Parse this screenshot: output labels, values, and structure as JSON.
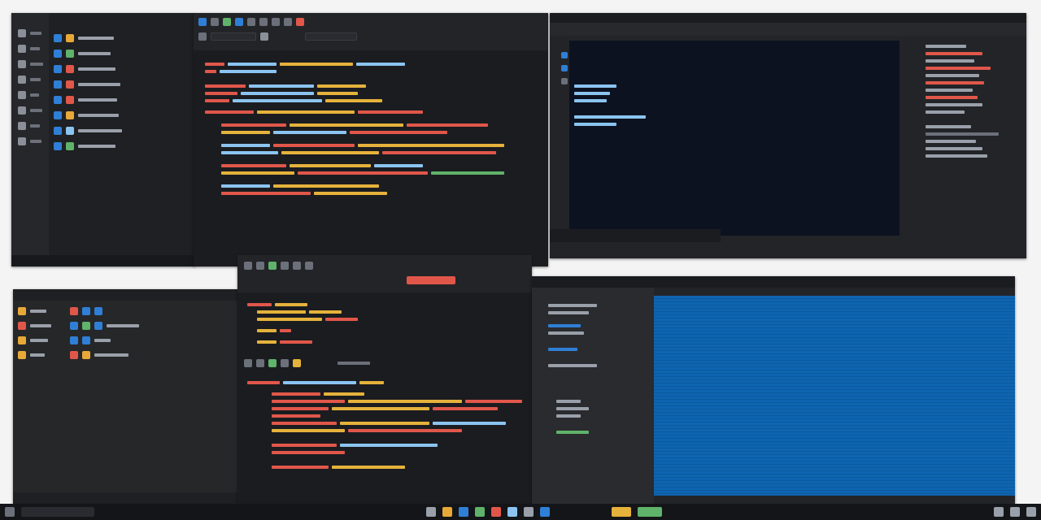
{
  "desktop_bg": "#f4f4f4",
  "windows": {
    "file_manager_top": {
      "bg": "#1f2023"
    },
    "code_editor_top": {
      "bg": "#1b1c20"
    },
    "terminal_top": {
      "bg": "#0d1220"
    },
    "file_manager_bottom": {
      "bg": "#262729"
    },
    "code_editor_bottom": {
      "bg": "#1b1c20"
    },
    "blue_app": {
      "bg": "#0e64b0"
    }
  },
  "colors": {
    "keyword": "#e0574a",
    "string": "#e5b23b",
    "identifier": "#8bc4f0",
    "comment": "#8a8f99",
    "green": "#5fb36a",
    "folder": "#e8a838",
    "accent_blue": "#2f7fd6"
  },
  "taskbar": {
    "icons": [
      "start-icon",
      "search-icon",
      "browser-icon",
      "folder-icon",
      "terminal-icon",
      "code-icon",
      "mail-icon",
      "photo-icon",
      "settings-icon",
      "store-icon",
      "music-icon",
      "chat-icon"
    ]
  }
}
